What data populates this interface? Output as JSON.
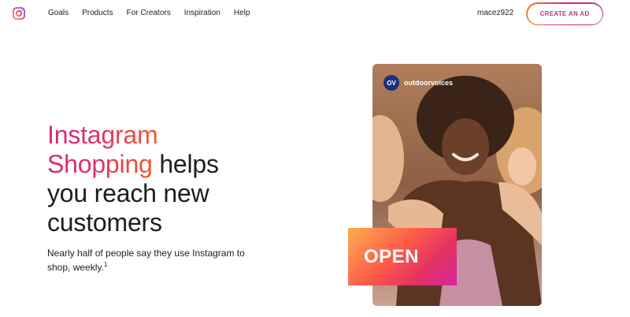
{
  "nav": {
    "logo_icon": "instagram-logo-icon",
    "links": [
      {
        "label": "Goals"
      },
      {
        "label": "Products"
      },
      {
        "label": "For Creators"
      },
      {
        "label": "Inspiration"
      },
      {
        "label": "Help"
      }
    ],
    "username": "macez922",
    "cta_label": "CREATE AN AD"
  },
  "hero": {
    "headline_part1": "Instagram",
    "headline_part2": "Shopping",
    "headline_part3": " helps",
    "headline_part4": "you reach new",
    "headline_part5": "customers",
    "subtext": "Nearly half of people say they use Instagram to shop, weekly.",
    "footnote": "1"
  },
  "card": {
    "avatar_initials": "OV",
    "account_name": "outdoorvoices",
    "sticker_text": "OPEN"
  },
  "colors": {
    "brand_pink": "#dd2a7b",
    "brand_orange": "#f58529",
    "avatar_bg": "#1d2f7d"
  }
}
